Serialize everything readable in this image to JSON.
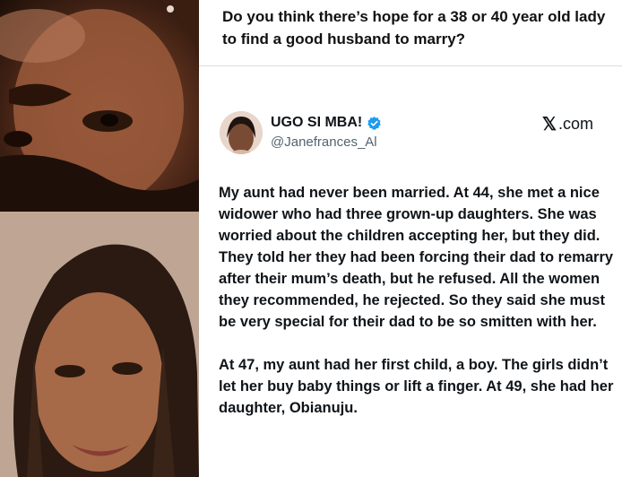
{
  "question": "Do you think there’s hope for a 38 or 40 year old lady to find a good husband to marry?",
  "tweet": {
    "display_name": "UGO SI MBA!",
    "handle": "@Janefrances_Al",
    "source": ".com",
    "source_icon": "x-logo-icon",
    "verified_color": "#1d9bf0",
    "paragraphs": [
      "My aunt had never been married. At 44, she met a nice widower who had three grown-up daughters. She was worried about the children accepting her, but they did. They told her they had been forcing their dad to remarry after their mum’s death, but he refused. All the women they recommended, he rejected. So they said she must be very special for their dad to be so smitten with her.",
      "At 47, my aunt had her first child, a boy. The girls didn’t let her buy baby things or lift a finger. At 49, she had her daughter, Obianuju."
    ]
  }
}
